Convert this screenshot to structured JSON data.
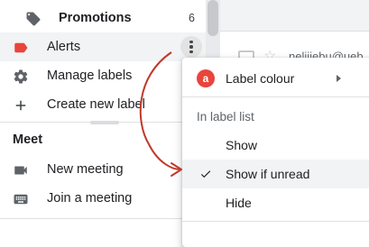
{
  "sidebar": {
    "items": [
      {
        "label": "Promotions",
        "count": "6",
        "icon": "tag-icon"
      },
      {
        "label": "Alerts",
        "icon": "label-icon",
        "icon_color": "#e8453c"
      },
      {
        "label": "Manage labels",
        "icon": "gear-icon"
      },
      {
        "label": "Create new label",
        "icon": "plus-icon"
      }
    ],
    "meet": {
      "title": "Meet",
      "items": [
        {
          "label": "New meeting",
          "icon": "video-camera-icon"
        },
        {
          "label": "Join a meeting",
          "icon": "keyboard-icon"
        }
      ]
    }
  },
  "email_peek": {
    "sender": "nelijiebu@ueb"
  },
  "context_menu": {
    "label_colour": {
      "label": "Label colour",
      "avatar_letter": "a",
      "avatar_color": "#e8453c"
    },
    "section_title": "In label list",
    "options": [
      {
        "label": "Show",
        "selected": false
      },
      {
        "label": "Show if unread",
        "selected": true
      },
      {
        "label": "Hide",
        "selected": false
      }
    ]
  },
  "annotation": {
    "arrow_color": "#c0392b"
  }
}
